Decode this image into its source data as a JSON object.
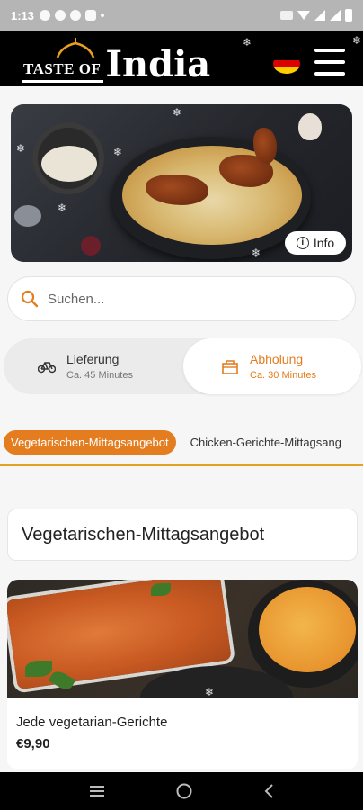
{
  "status_bar": {
    "time": "1:13"
  },
  "header": {
    "logo_small": "TASTE OF",
    "logo_big": "India",
    "flag": [
      "#000000",
      "#dd0000",
      "#ffce00"
    ]
  },
  "hero": {
    "info_label": "Info"
  },
  "search": {
    "placeholder": "Suchen..."
  },
  "order_mode": {
    "delivery": {
      "label": "Lieferung",
      "time": "Ca. 45 Minutes"
    },
    "pickup": {
      "label": "Abholung",
      "time": "Ca. 30 Minutes"
    },
    "selected": "pickup"
  },
  "categories": {
    "active": "Vegetarischen-Mittagsangebot",
    "next": "Chicken-Gerichte-Mittagsang"
  },
  "section": {
    "title": "Vegetarischen-Mittagsangebot"
  },
  "items": [
    {
      "name": "Jede vegetarian-Gerichte",
      "price": "€9,90"
    }
  ],
  "colors": {
    "accent": "#e37d1f",
    "header_bg": "#000000",
    "underline": "#e3a21f"
  }
}
